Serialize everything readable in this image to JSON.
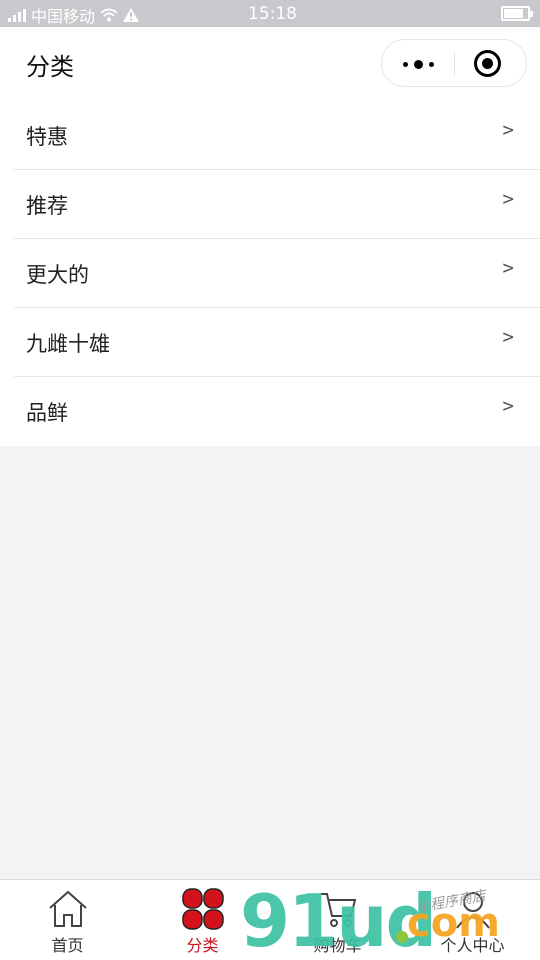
{
  "status_bar": {
    "carrier": "中国移动",
    "time": "15:18"
  },
  "nav": {
    "title": "分类"
  },
  "categories": [
    {
      "label": "特惠",
      "chevron": ">"
    },
    {
      "label": "推荐",
      "chevron": ">"
    },
    {
      "label": "更大的",
      "chevron": ">"
    },
    {
      "label": "九雌十雄",
      "chevron": ">"
    },
    {
      "label": "品鲜",
      "chevron": ">"
    }
  ],
  "tabs": [
    {
      "label": "首页",
      "icon": "home-icon",
      "active": false
    },
    {
      "label": "分类",
      "icon": "category-icon",
      "active": true
    },
    {
      "label": "购物车",
      "icon": "cart-icon",
      "active": false
    },
    {
      "label": "个人中心",
      "icon": "user-icon",
      "active": false
    }
  ],
  "watermark": {
    "digits": "91ud",
    "suffix": "com",
    "script": "小程序商店"
  },
  "colors": {
    "accent": "#c8141e",
    "status_bar_bg": "#c9c8cc",
    "page_bg": "#f3f2f5",
    "watermark_green": "#3cc2a4",
    "watermark_orange": "#f5a623"
  }
}
